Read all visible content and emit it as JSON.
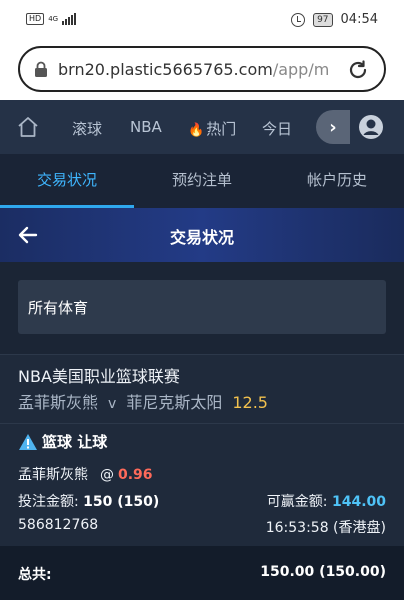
{
  "statusbar": {
    "hd": "HD",
    "network": "4G",
    "battery": "97",
    "time": "04:54"
  },
  "browser": {
    "url_host": "brn20.plastic5665765.com",
    "url_path": "/app/m"
  },
  "topnav": {
    "items": [
      {
        "label": "滚球"
      },
      {
        "label": "NBA"
      },
      {
        "label": "热门",
        "icon": "fire-icon"
      },
      {
        "label": "今日"
      }
    ],
    "arrow": "›"
  },
  "tabs": [
    {
      "label": "交易状况",
      "active": true
    },
    {
      "label": "预约注单"
    },
    {
      "label": "帐户历史"
    }
  ],
  "page": {
    "title": "交易状况"
  },
  "filter": {
    "value": "所有体育"
  },
  "bet": {
    "league": "NBA美国职业篮球联赛",
    "home": "孟菲斯灰熊",
    "vs": "v",
    "away": "菲尼克斯太阳",
    "line": "12.5",
    "market": "篮球 让球",
    "selection": "孟菲斯灰熊",
    "at": "@",
    "odds": "0.96",
    "stake_label": "投注金额:",
    "stake_value": "150 (150)",
    "win_label": "可赢金额:",
    "win_value": "144.00",
    "bet_id": "586812768",
    "bet_time": "16:53:58 (香港盘)"
  },
  "total": {
    "label": "总共:",
    "value": "150.00 (150.00)"
  },
  "colors": {
    "accent": "#3fb6ff",
    "odds": "#ff6a5a",
    "line": "#f2c14e",
    "win": "#4fc3f7"
  }
}
